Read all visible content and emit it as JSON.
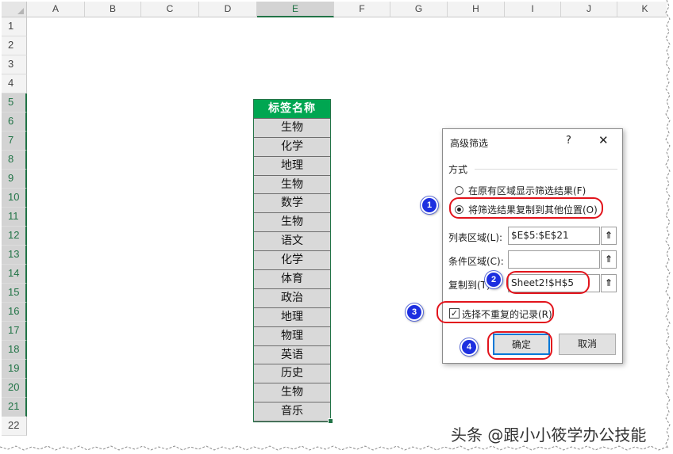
{
  "columns": [
    "A",
    "B",
    "C",
    "D",
    "E",
    "F",
    "G",
    "H",
    "I",
    "J",
    "K"
  ],
  "rows": [
    "1",
    "2",
    "3",
    "4",
    "5",
    "6",
    "7",
    "8",
    "9",
    "10",
    "11",
    "12",
    "13",
    "14",
    "15",
    "16",
    "17",
    "18",
    "19",
    "20",
    "21",
    "22"
  ],
  "table": {
    "header": "标签名称",
    "items": [
      "生物",
      "化学",
      "地理",
      "生物",
      "数学",
      "生物",
      "语文",
      "化学",
      "体育",
      "政治",
      "地理",
      "物理",
      "英语",
      "历史",
      "生物",
      "音乐"
    ]
  },
  "dialog": {
    "title": "高级筛选",
    "help": "?",
    "close": "✕",
    "group_label": "方式",
    "radio1": "在原有区域显示筛选结果(F)",
    "radio2": "将筛选结果复制到其他位置(O)",
    "list_range_label": "列表区域(L):",
    "list_range_value": "$E$5:$E$21",
    "criteria_label": "条件区域(C):",
    "criteria_value": "",
    "copy_to_label": "复制到(T):",
    "copy_to_value": "Sheet2!$H$5",
    "collapse_icon": "⇑",
    "unique_label": "选择不重复的记录(R)",
    "unique_checked": "✓",
    "ok": "确定",
    "cancel": "取消"
  },
  "badges": [
    "1",
    "2",
    "3",
    "4"
  ],
  "watermark": "头条 @跟小小筱学办公技能",
  "colors": {
    "header_green": "#00a651",
    "cell_gray": "#d9d9d9",
    "annotation_red": "#e2141c",
    "badge_blue": "#1d2fe0"
  }
}
